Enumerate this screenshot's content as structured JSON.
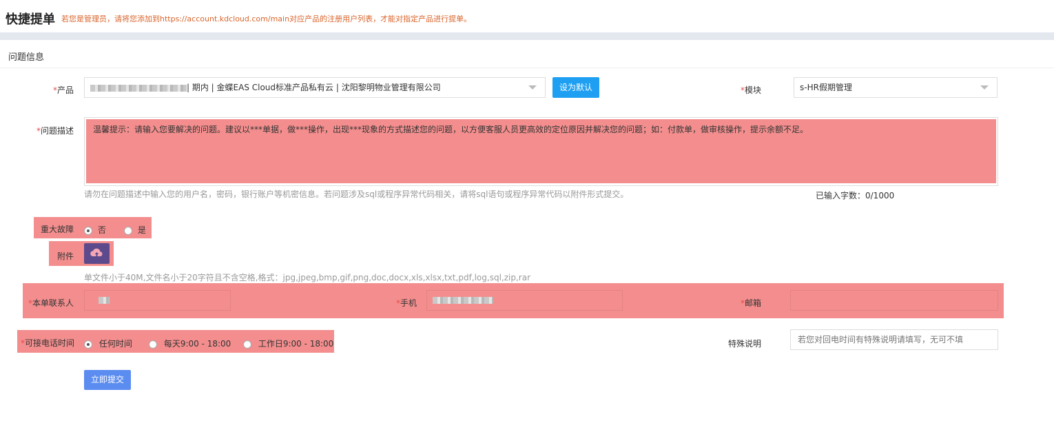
{
  "header": {
    "title": "快捷提单",
    "notice": "若您是管理员，请将您添加到https://account.kdcloud.com/main对应产品的注册用户列表，才能对指定产品进行提单。"
  },
  "section_title": "问题信息",
  "product": {
    "label": "产品",
    "value": "| 期内 | 金蝶EAS Cloud标准产品私有云 | 沈阳黎明物业管理有限公司",
    "set_default": "设为默认"
  },
  "module": {
    "label": "模块",
    "value": "s-HR假期管理"
  },
  "description": {
    "label": "问题描述",
    "placeholder": "温馨提示：请输入您要解决的问题。建议以***单据，做***操作，出现***现象的方式描述您的问题，以方便客服人员更高效的定位原因并解决您的问题；如：付款单，做审核操作，提示余额不足。",
    "warning": "请勿在问题描述中输入您的用户名，密码，银行账户等机密信息。若问题涉及sql或程序异常代码相关，请将sql语句或程序异常代码以附件形式提交。",
    "count": "已输入字数：0/1000"
  },
  "major_fault": {
    "label": "重大故障",
    "options": [
      "否",
      "是"
    ],
    "selected": "否"
  },
  "attachment": {
    "label": "附件",
    "hint": "单文件小于40M,文件名小于20字符且不含空格,格式：jpg,jpeg,bmp,gif,png,doc,docx,xls,xlsx,txt,pdf,log,sql,zip,rar"
  },
  "contact": {
    "label": "本单联系人"
  },
  "phone": {
    "label": "手机"
  },
  "email": {
    "label": "邮箱"
  },
  "call_time": {
    "label": "可接电话时间",
    "options": [
      "任何时间",
      "每天9:00 - 18:00",
      "工作日9:00 - 18:00"
    ],
    "selected": "任何时间"
  },
  "special": {
    "label": "特殊说明",
    "placeholder": "若您对回电时间有特殊说明请填写，无可不填"
  },
  "submit_label": "立即提交",
  "required_mark": "*",
  "colors": {
    "accent": "#1e9ff2",
    "highlight": "#f48e8e",
    "notice": "#d9642b"
  }
}
